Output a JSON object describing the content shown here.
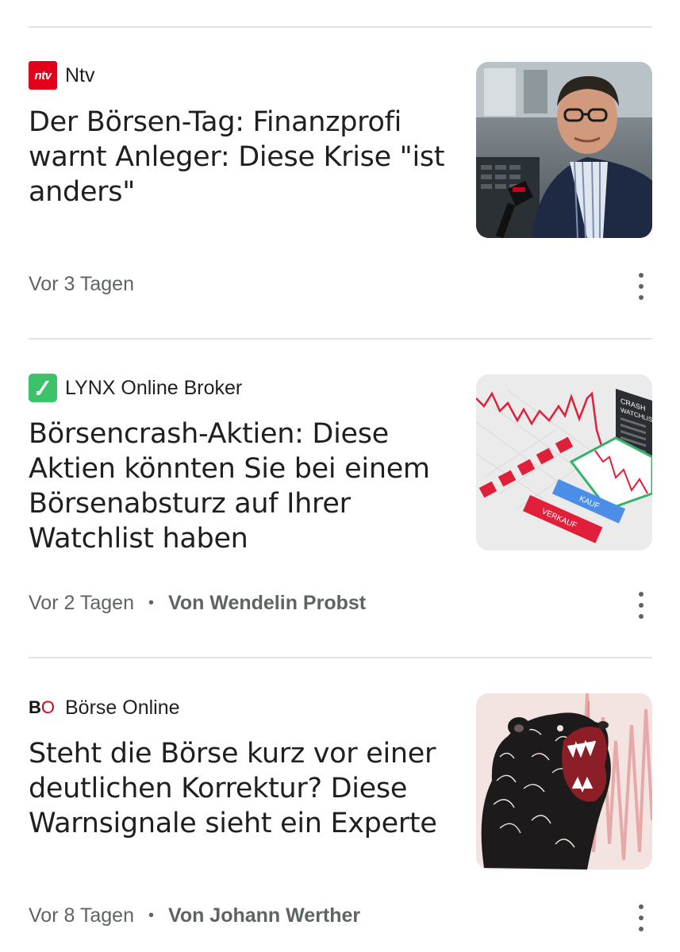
{
  "articles": [
    {
      "source": {
        "name": "Ntv",
        "logo_text": "ntv",
        "logo_color": "#e2001a",
        "logo_icon": "ntv-logo"
      },
      "headline": "Der Börsen-Tag: Finanzprofi warnt Anleger: Diese Krise \"ist anders\"",
      "time": "Vor 3 Tagen",
      "author": "",
      "thumbnail": "man-with-microphone-at-stock-exchange"
    },
    {
      "source": {
        "name": "LYNX Online Broker",
        "logo_text": "",
        "logo_color": "#3cc26a",
        "logo_icon": "lynx-slash-logo"
      },
      "headline": "Börsencrash-Aktien: Diese Aktien könnten Sie bei einem Börsenabsturz auf Ihrer Watchlist haben",
      "time": "Vor 2 Tagen",
      "author": "Von Wendelin Probst",
      "thumbnail": "crash-chart-with-kauf-verkauf-keys",
      "thumb_labels": {
        "kauf": "KAUF",
        "verkauf": "VERKAUF",
        "crash": "CRASH",
        "watchlist": "WATCHLIST"
      }
    },
    {
      "source": {
        "name": "Börse Online",
        "logo_text": "BO",
        "logo_color": "#d0021b",
        "logo_icon": "bo-logo"
      },
      "headline": "Steht die Börse kurz vor einer deutlichen Korrektur? Diese Warnsignale sieht ein Experte",
      "time": "Vor 8 Tagen",
      "author": "Von Johann Werther",
      "thumbnail": "roaring-bear-illustration"
    }
  ],
  "colors": {
    "divider": "#e3e3e3",
    "meta_text": "#5f6368",
    "headline_text": "#1f1f1f"
  },
  "icons": {
    "more": "more-vert-icon"
  }
}
